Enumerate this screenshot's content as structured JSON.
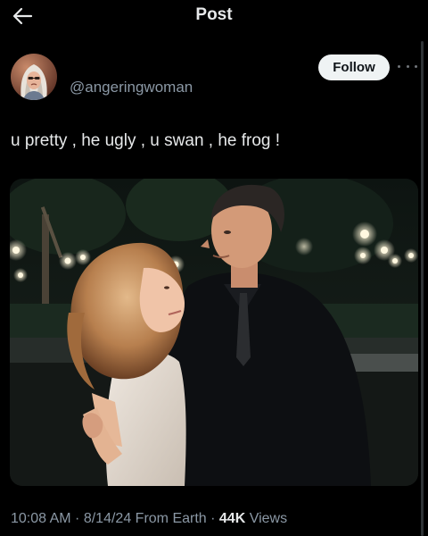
{
  "header": {
    "title": "Post",
    "back_icon": "arrow-left-icon"
  },
  "author": {
    "handle": "@angeringwoman",
    "avatar_icon": "avatar-woman-headscarf",
    "follow_label": "Follow",
    "more_icon": "more-horizontal-icon"
  },
  "post": {
    "text": "u pretty , he ugly , u swan , he frog !",
    "media_description_icon": "photo-couple-night-scene"
  },
  "meta": {
    "time": "10:08 AM",
    "sep1": " · ",
    "date": "8/14/24",
    "source": " From Earth",
    "sep2": " · ",
    "views_count": "44K",
    "views_label": " Views"
  },
  "colors": {
    "background": "#000000",
    "text_primary": "#e7e9ea",
    "text_secondary": "#8b98a5",
    "follow_bg": "#eff3f4",
    "follow_text": "#0f1419"
  }
}
